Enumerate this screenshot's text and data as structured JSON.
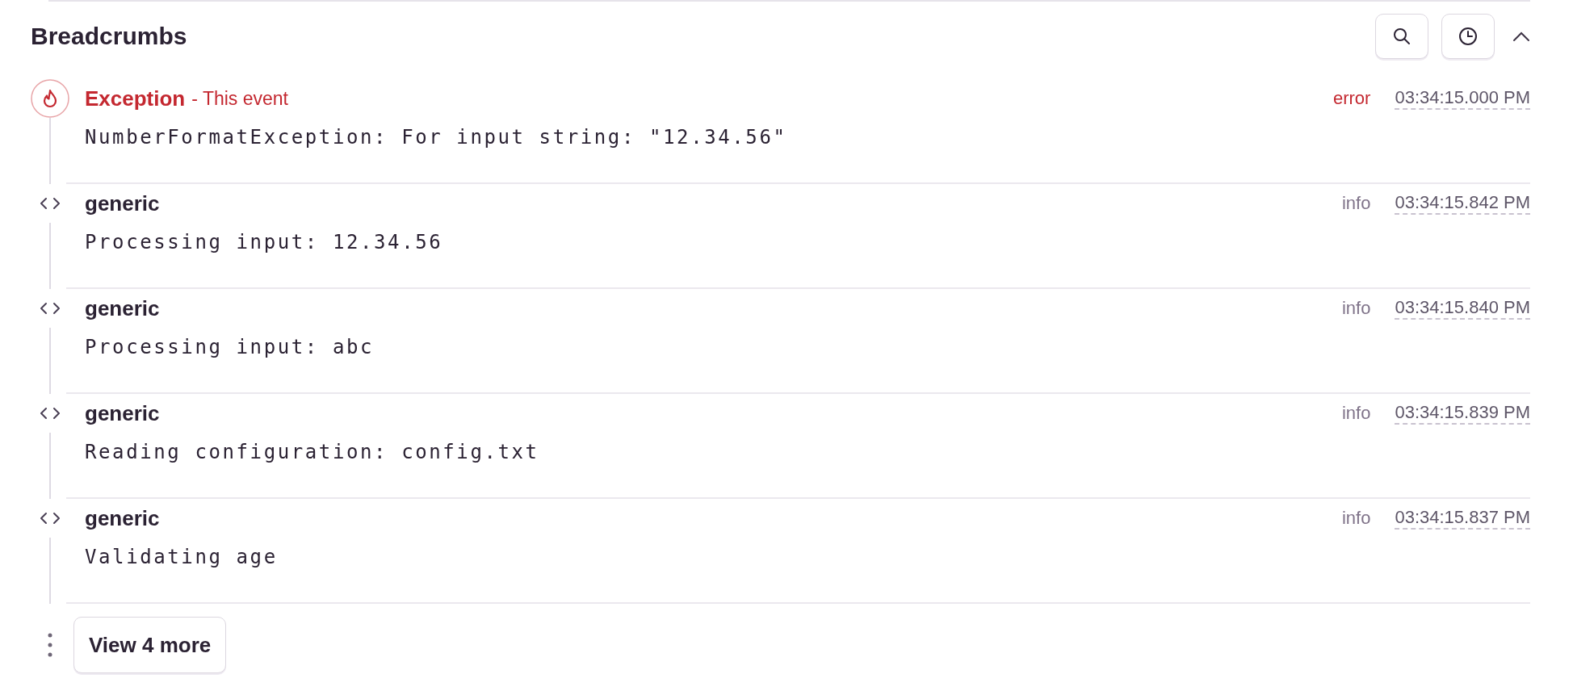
{
  "panel": {
    "title": "Breadcrumbs"
  },
  "breadcrumbs": [
    {
      "kind": "exception",
      "title": "Exception",
      "note": "- This event",
      "level": "error",
      "time": "03:34:15.000 PM",
      "message": "NumberFormatException: For input string: \"12.34.56\""
    },
    {
      "kind": "generic",
      "title": "generic",
      "level": "info",
      "time": "03:34:15.842 PM",
      "message": "Processing input: 12.34.56"
    },
    {
      "kind": "generic",
      "title": "generic",
      "level": "info",
      "time": "03:34:15.840 PM",
      "message": "Processing input: abc"
    },
    {
      "kind": "generic",
      "title": "generic",
      "level": "info",
      "time": "03:34:15.839 PM",
      "message": "Reading configuration: config.txt"
    },
    {
      "kind": "generic",
      "title": "generic",
      "level": "info",
      "time": "03:34:15.837 PM",
      "message": "Validating age"
    }
  ],
  "more_button": "View 4 more"
}
